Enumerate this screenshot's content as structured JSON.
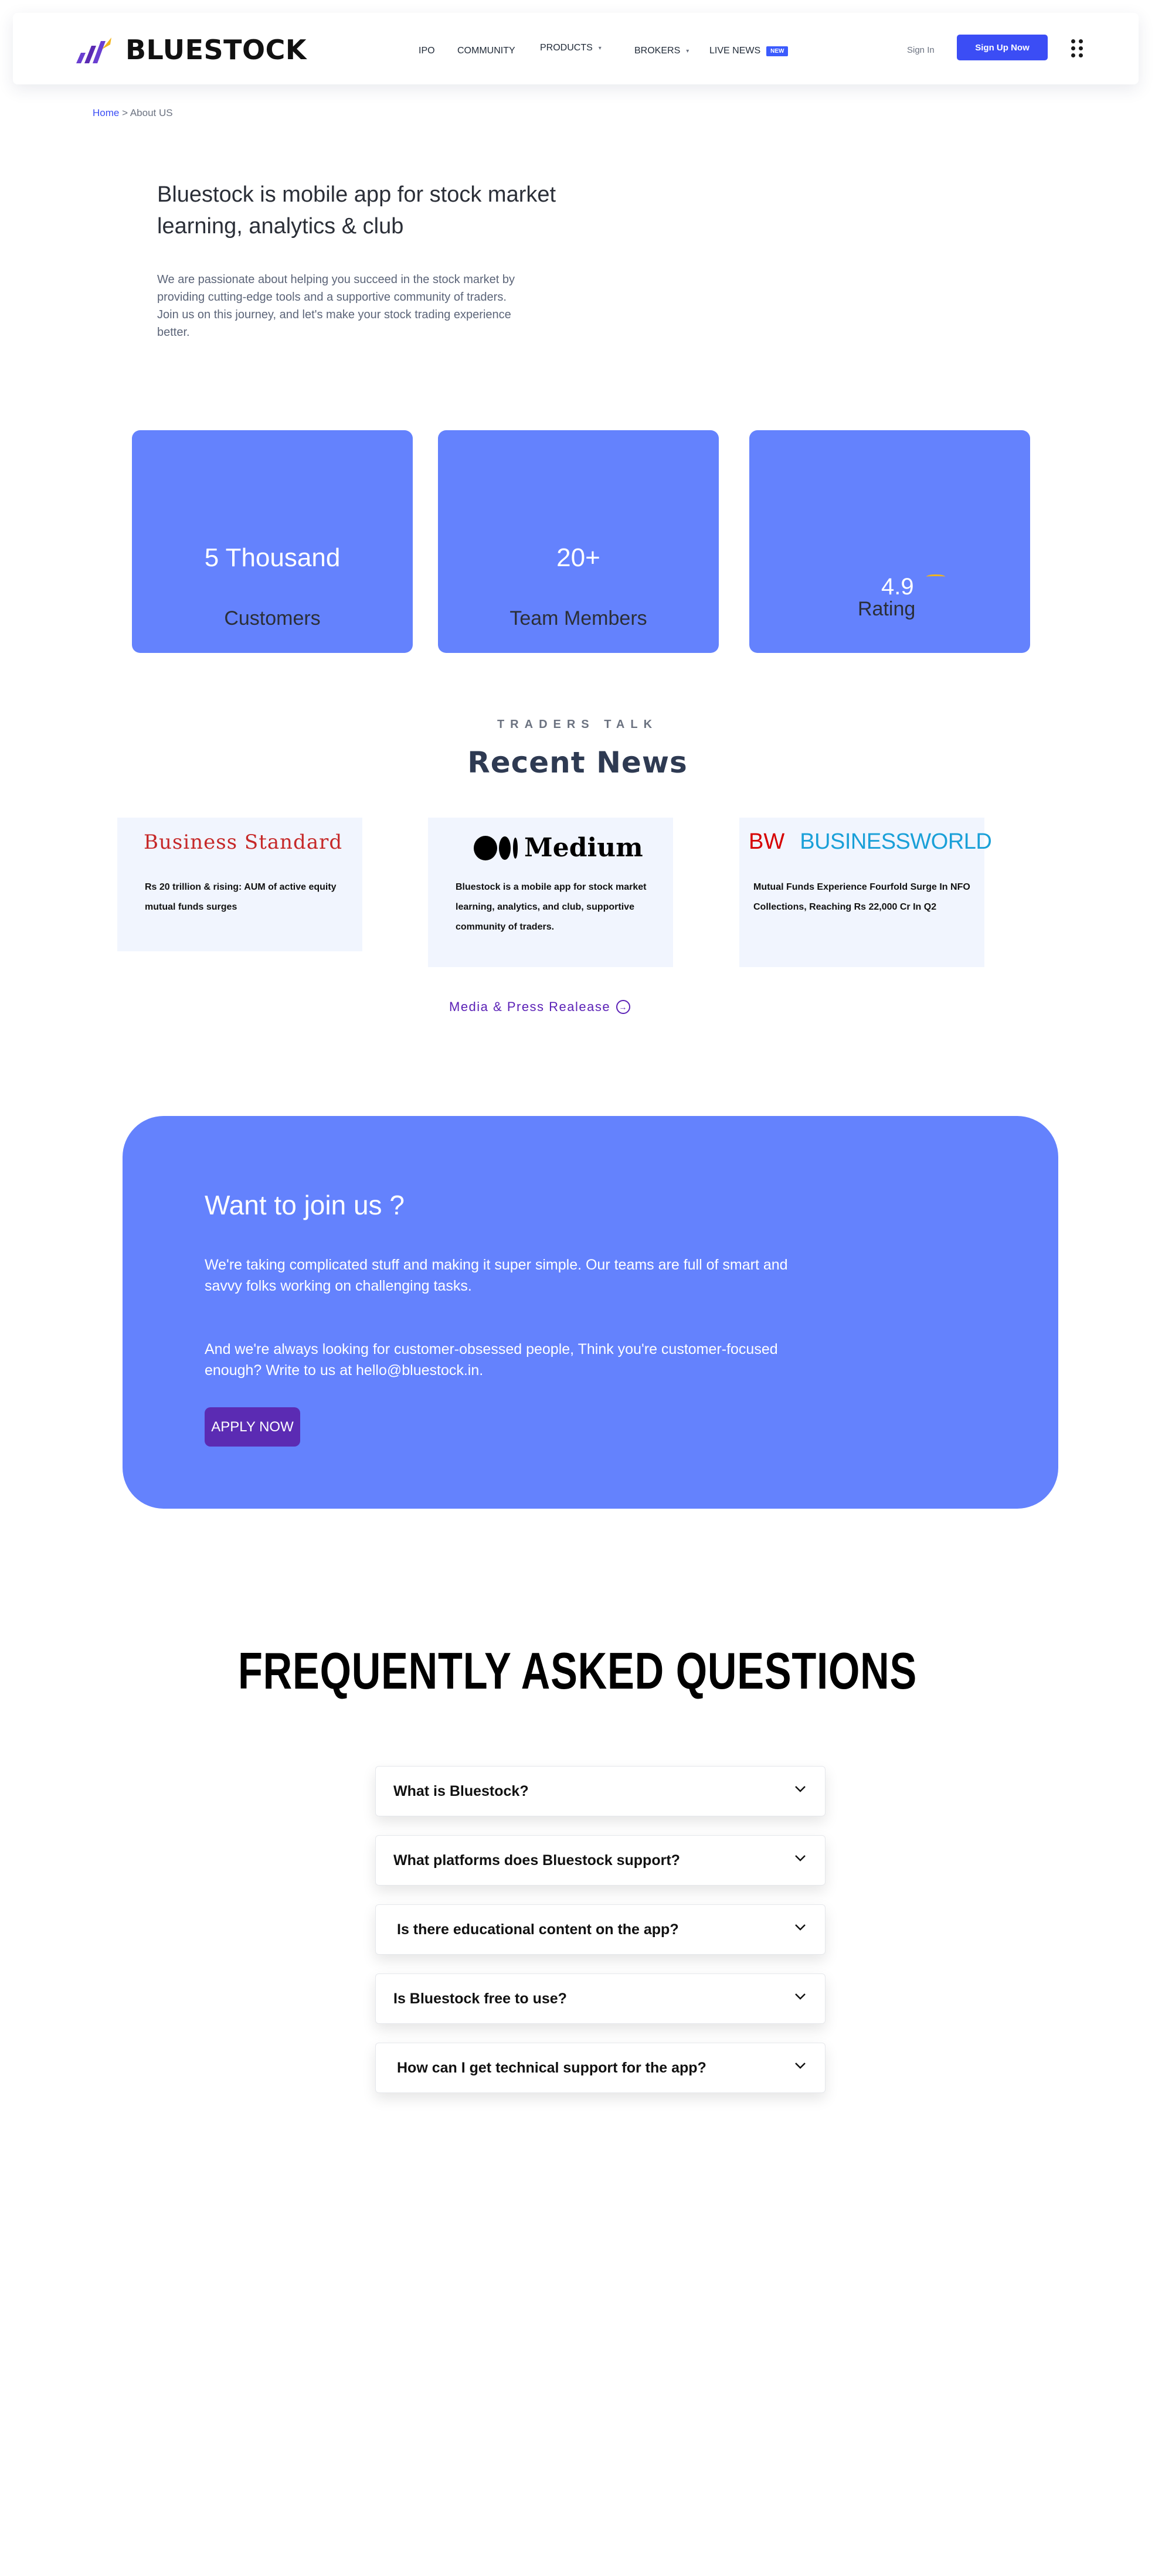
{
  "header": {
    "brand": "BLUESTOCK",
    "nav": [
      {
        "label": "IPO",
        "caret": false,
        "badge": ""
      },
      {
        "label": "COMMUNITY",
        "caret": false,
        "badge": ""
      },
      {
        "label": "PRODUCTS",
        "caret": true,
        "badge": ""
      },
      {
        "label": "BROKERS",
        "caret": true,
        "badge": ""
      },
      {
        "label": "LIVE NEWS",
        "caret": false,
        "badge": "NEW"
      }
    ],
    "sign_in": "Sign In",
    "sign_up": "Sign Up Now"
  },
  "breadcrumb": {
    "home": "Home",
    "separator": ">",
    "current": "About US"
  },
  "intro": {
    "title": "Bluestock is mobile app for stock market learning, analytics & club",
    "text_line1": "We are passionate about helping you succeed in the stock market by providing cutting-edge tools and a supportive community of traders.",
    "text_line2": "Join us on this journey, and let's make your stock trading experience better."
  },
  "stats": [
    {
      "value": "5 Thousand",
      "label": "Customers"
    },
    {
      "value": "20+",
      "label": "Team Members"
    },
    {
      "value": "4.9",
      "label": "Rating"
    }
  ],
  "news": {
    "eyebrow": "TRADERS TALK",
    "title": "Recent News",
    "cards": [
      {
        "source": "Business Standard",
        "text": "Rs 20 trillion & rising: AUM of active equity mutual funds surges"
      },
      {
        "source": "Medium",
        "text": "Bluestock is a mobile app for stock market learning, analytics, and club, supportive community of traders."
      },
      {
        "source_short": "BW",
        "source": "BUSINESSWORLD",
        "text": "Mutual Funds Experience Fourfold Surge In NFO Collections, Reaching Rs 22,000 Cr In Q2"
      }
    ],
    "more_link": "Media & Press Realease"
  },
  "join": {
    "title": "Want to join us ?",
    "p1": "We're taking complicated stuff and making it super simple. Our teams are full of smart and savvy folks working on challenging tasks.",
    "p2": "And we're always looking for customer-obsessed people, Think you're customer-focused enough? Write to us at hello@bluestock.in.",
    "button": "APPLY NOW"
  },
  "faq": {
    "title": "FREQUENTLY ASKED QUESTIONS",
    "items": [
      "What is Bluestock?",
      "What platforms does Bluestock support?",
      "Is there educational content on the app?",
      "Is Bluestock free to use?",
      "How can I get technical support for the app?"
    ]
  },
  "colors": {
    "accent": "#3b4df5",
    "card": "#6482fd",
    "purple": "#5b2bb3",
    "news_bg": "#f1f5fe"
  }
}
